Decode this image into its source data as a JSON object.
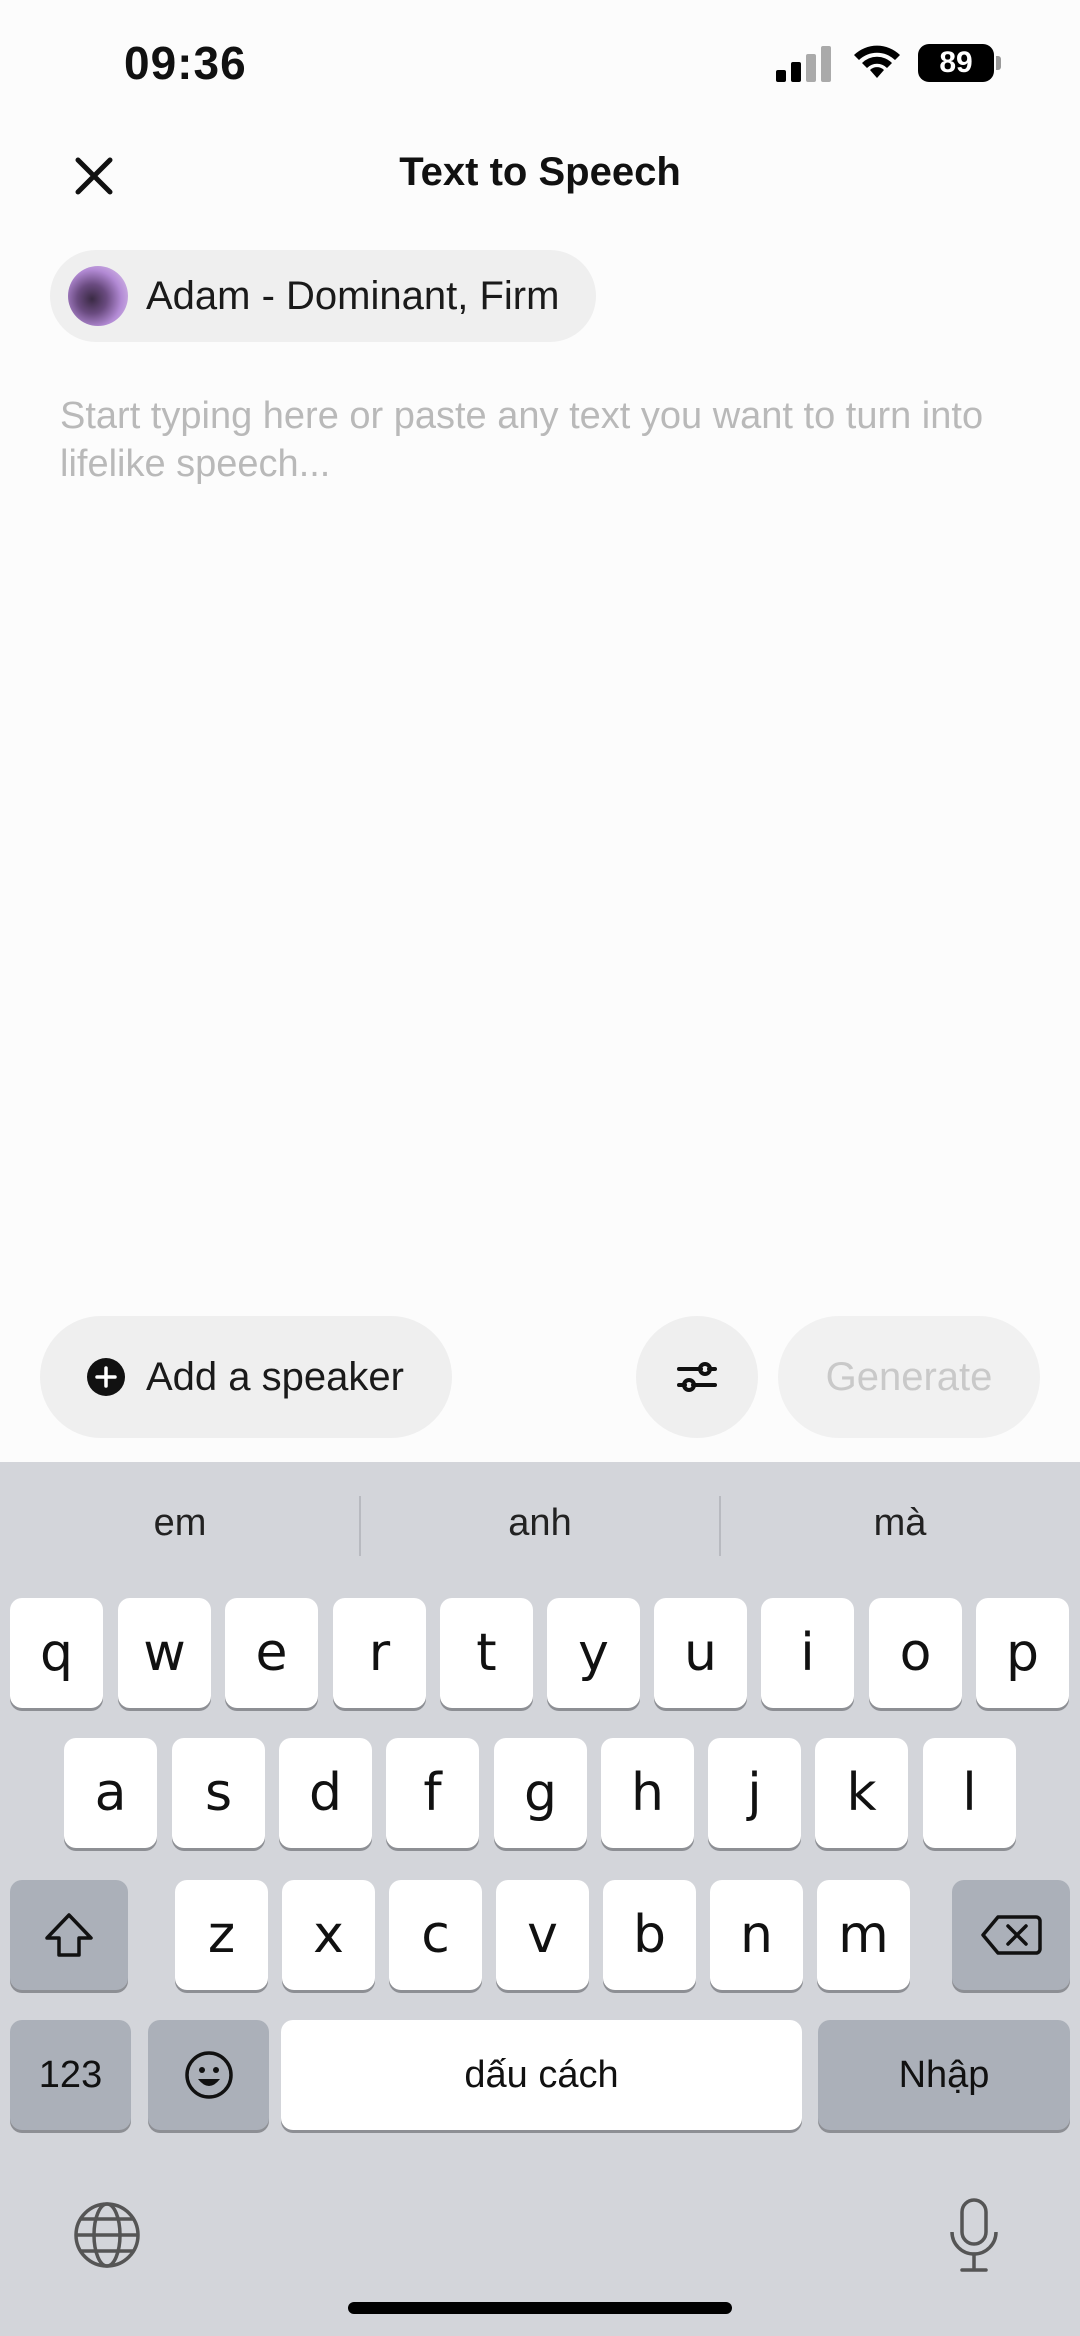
{
  "status_bar": {
    "time": "09:36",
    "battery": "89"
  },
  "header": {
    "title": "Text to Speech"
  },
  "voice": {
    "name": "Adam - Dominant, Firm"
  },
  "editor": {
    "placeholder": "Start typing here or paste any text you want to turn into lifelike speech..."
  },
  "actions": {
    "add_speaker": "Add a speaker",
    "generate": "Generate"
  },
  "keyboard": {
    "suggestions": [
      "em",
      "anh",
      "mà"
    ],
    "row1": [
      "q",
      "w",
      "e",
      "r",
      "t",
      "y",
      "u",
      "i",
      "o",
      "p"
    ],
    "row2": [
      "a",
      "s",
      "d",
      "f",
      "g",
      "h",
      "j",
      "k",
      "l"
    ],
    "row3": [
      "z",
      "x",
      "c",
      "v",
      "b",
      "n",
      "m"
    ],
    "numbers_key": "123",
    "space_key": "dấu cách",
    "return_key": "Nhập"
  }
}
